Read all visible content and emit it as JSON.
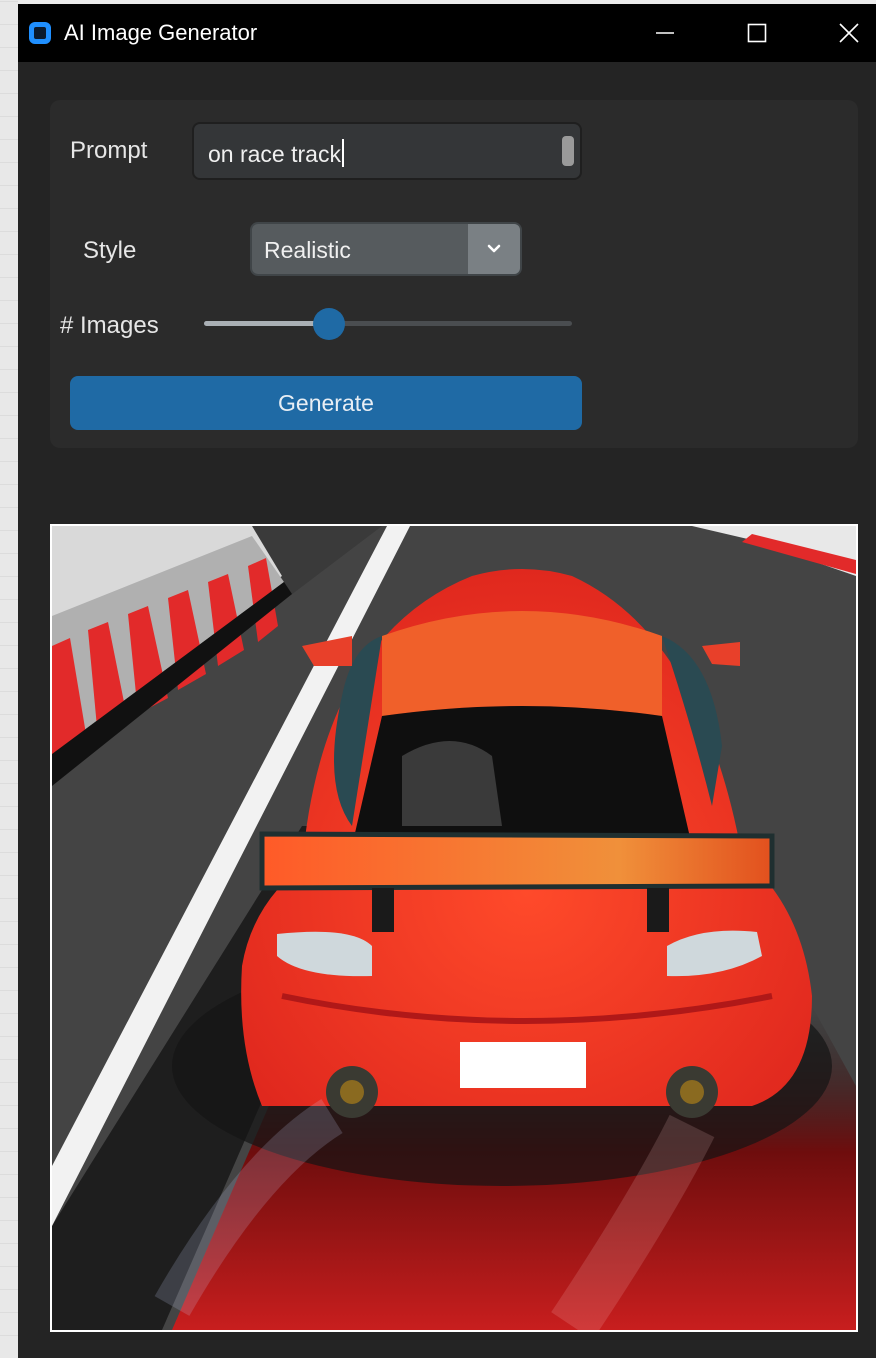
{
  "window": {
    "title": "AI Image Generator",
    "icons": [
      "app-icon",
      "minimize-icon",
      "maximize-icon",
      "close-icon"
    ]
  },
  "form": {
    "prompt_label": "Prompt",
    "prompt_value": "on race track",
    "style_label": "Style",
    "style_value": "Realistic",
    "images_label": "# Images",
    "images_slider_fraction": 0.34,
    "generate_label": "Generate"
  },
  "colors": {
    "window_bg": "#242424",
    "panel_bg": "#2b2b2b",
    "accent": "#1f6aa5",
    "titlebar": "#000000"
  }
}
